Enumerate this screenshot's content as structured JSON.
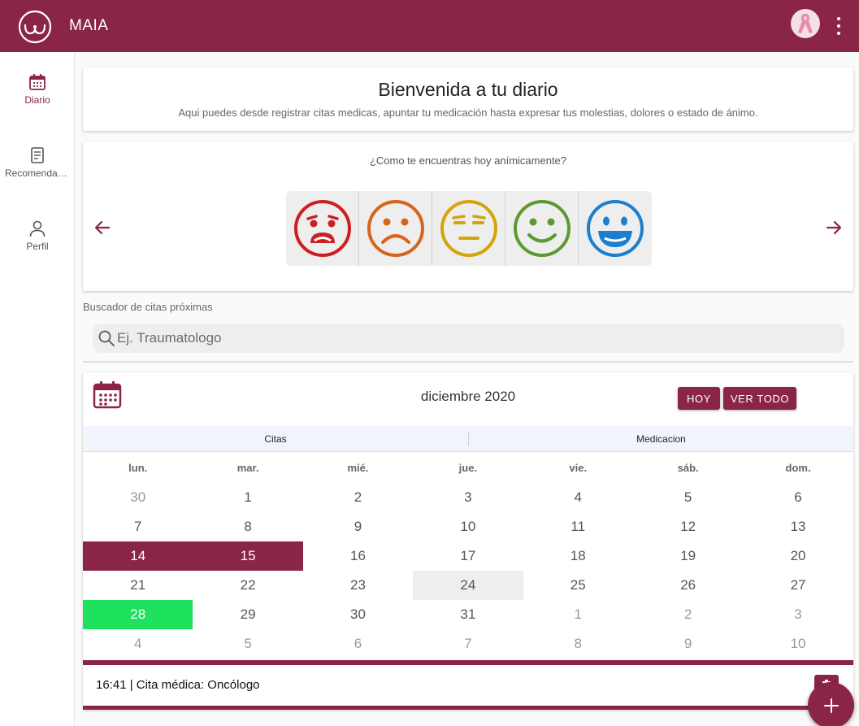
{
  "app": {
    "title": "MAIA",
    "brand_color": "#8b2545"
  },
  "sidebar": {
    "items": [
      {
        "label": "Diario",
        "icon": "calendar-icon",
        "active": true
      },
      {
        "label": "Recomendaciones",
        "icon": "document-icon",
        "active": false
      },
      {
        "label": "Perfil",
        "icon": "person-icon",
        "active": false
      }
    ]
  },
  "welcome": {
    "title": "Bienvenida a tu diario",
    "subtitle": "Aqui puedes desde registrar citas medicas, apuntar tu medicación hasta expresar tus molestias, dolores o estado de ánimo."
  },
  "mood": {
    "question": "¿Como te encuentras hoy anímicamente?",
    "faces": [
      {
        "icon": "very-sad-face-icon",
        "color": "#cc1f1f"
      },
      {
        "icon": "sad-face-icon",
        "color": "#d8641c"
      },
      {
        "icon": "neutral-face-icon",
        "color": "#d4a40c"
      },
      {
        "icon": "smile-face-icon",
        "color": "#5c9a31"
      },
      {
        "icon": "happy-face-icon",
        "color": "#1b7fd1"
      }
    ]
  },
  "search": {
    "label": "Buscador de citas próximas",
    "placeholder": "Ej. Traumatologo"
  },
  "calendar": {
    "month": "diciembre 2020",
    "today_button": "HOY",
    "view_all_button": "VER TODO",
    "tabs": [
      "Citas",
      "Medicacion"
    ],
    "weekdays": [
      "lun.",
      "mar.",
      "mié.",
      "jue.",
      "vie.",
      "sáb.",
      "dom."
    ],
    "weeks": [
      [
        "30",
        "1",
        "2",
        "3",
        "4",
        "5",
        "6"
      ],
      [
        "7",
        "8",
        "9",
        "10",
        "11",
        "12",
        "13"
      ],
      [
        "14",
        "15",
        "16",
        "17",
        "18",
        "19",
        "20"
      ],
      [
        "21",
        "22",
        "23",
        "24",
        "25",
        "26",
        "27"
      ],
      [
        "28",
        "29",
        "30",
        "31",
        "1",
        "2",
        "3"
      ],
      [
        "4",
        "5",
        "6",
        "7",
        "8",
        "9",
        "10"
      ]
    ],
    "selected_color": "#8b2545",
    "event_color": "#1ee15e",
    "today_color": "#eeeeee"
  },
  "event": {
    "text": "16:41 | Cita médica: Oncólogo"
  }
}
